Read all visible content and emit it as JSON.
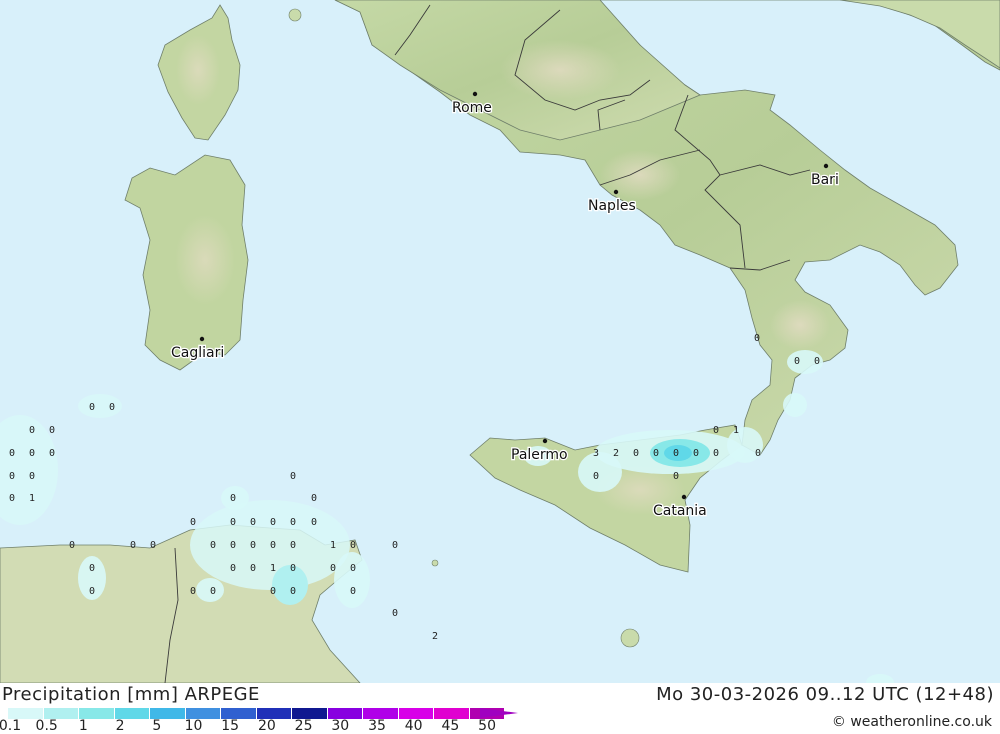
{
  "map": {
    "cities": [
      {
        "name": "Rome"
      },
      {
        "name": "Naples"
      },
      {
        "name": "Bari"
      },
      {
        "name": "Cagliari"
      },
      {
        "name": "Palermo"
      },
      {
        "name": "Catania"
      }
    ],
    "precip_values": [
      "0",
      "0",
      "0",
      "0",
      "0",
      "0",
      "0",
      "0",
      "0",
      "0",
      "1",
      "0",
      "0",
      "0",
      "0",
      "0",
      "0",
      "0",
      "0",
      "0",
      "0",
      "0",
      "0",
      "0",
      "0",
      "0",
      "0",
      "0",
      "1",
      "0",
      "0",
      "0",
      "0",
      "1",
      "0",
      "0",
      "0",
      "0",
      "0",
      "0",
      "0",
      "0",
      "0",
      "0",
      "0",
      "2",
      "3",
      "2",
      "0",
      "0",
      "0",
      "0",
      "0",
      "1",
      "0",
      "0",
      "0",
      "0",
      "0",
      "0",
      "0"
    ]
  },
  "footer": {
    "title": "Precipitation [mm] ARPEGE",
    "datetime": "Mo 30-03-2026 09..12 UTC (12+48)",
    "credit": "© weatheronline.co.uk"
  },
  "legend": {
    "labels": [
      "0.1",
      "0.5",
      "1",
      "2",
      "5",
      "10",
      "15",
      "20",
      "25",
      "30",
      "35",
      "40",
      "45",
      "50"
    ],
    "colors": [
      "#d8f8f8",
      "#b0f0f0",
      "#88e8e8",
      "#60d8e8",
      "#40b8e8",
      "#4090e0",
      "#3060d0",
      "#2030b8",
      "#101890",
      "#8800e0",
      "#b000e8",
      "#d800e8",
      "#e000d0",
      "#b000b0"
    ]
  }
}
